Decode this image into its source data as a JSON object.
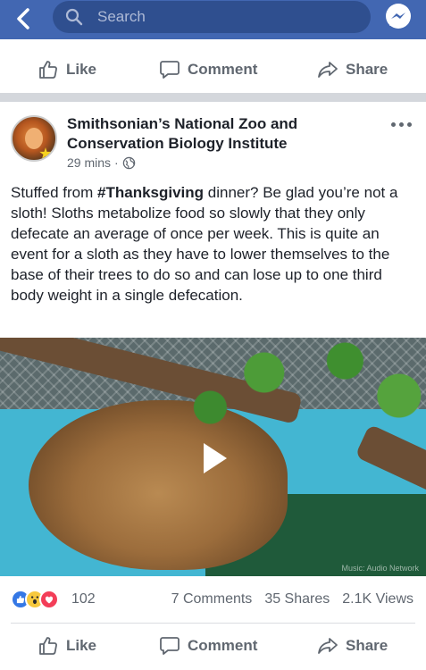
{
  "header": {
    "search_placeholder": "Search",
    "back_icon": "back-arrow-icon",
    "messenger_icon": "messenger-icon",
    "bar_color": "#4267b2"
  },
  "top_actions": {
    "like": "Like",
    "comment": "Comment",
    "share": "Share"
  },
  "post": {
    "page_name": "Smithsonian’s National Zoo and Conservation Biology Institute",
    "time": "29 mins",
    "meta_separator": "·",
    "privacy_icon": "globe-icon",
    "text_before": "Stuffed from ",
    "hashtag": "#Thanksgiving",
    "text_after": " dinner? Be glad you’re not a sloth! Sloths metabolize food so slowly that they only defecate an average of once per week. This is quite an event for a sloth as they have to lower themselves to the base of their trees to do so and can lose up to one third body weight in a single defecation.",
    "video_watermark": "Music: Audio Network"
  },
  "stats": {
    "reaction_count": "102",
    "comments": "7 Comments",
    "shares": "35 Shares",
    "views": "2.1K Views"
  },
  "bottom_actions": {
    "like": "Like",
    "comment": "Comment",
    "share": "Share"
  }
}
